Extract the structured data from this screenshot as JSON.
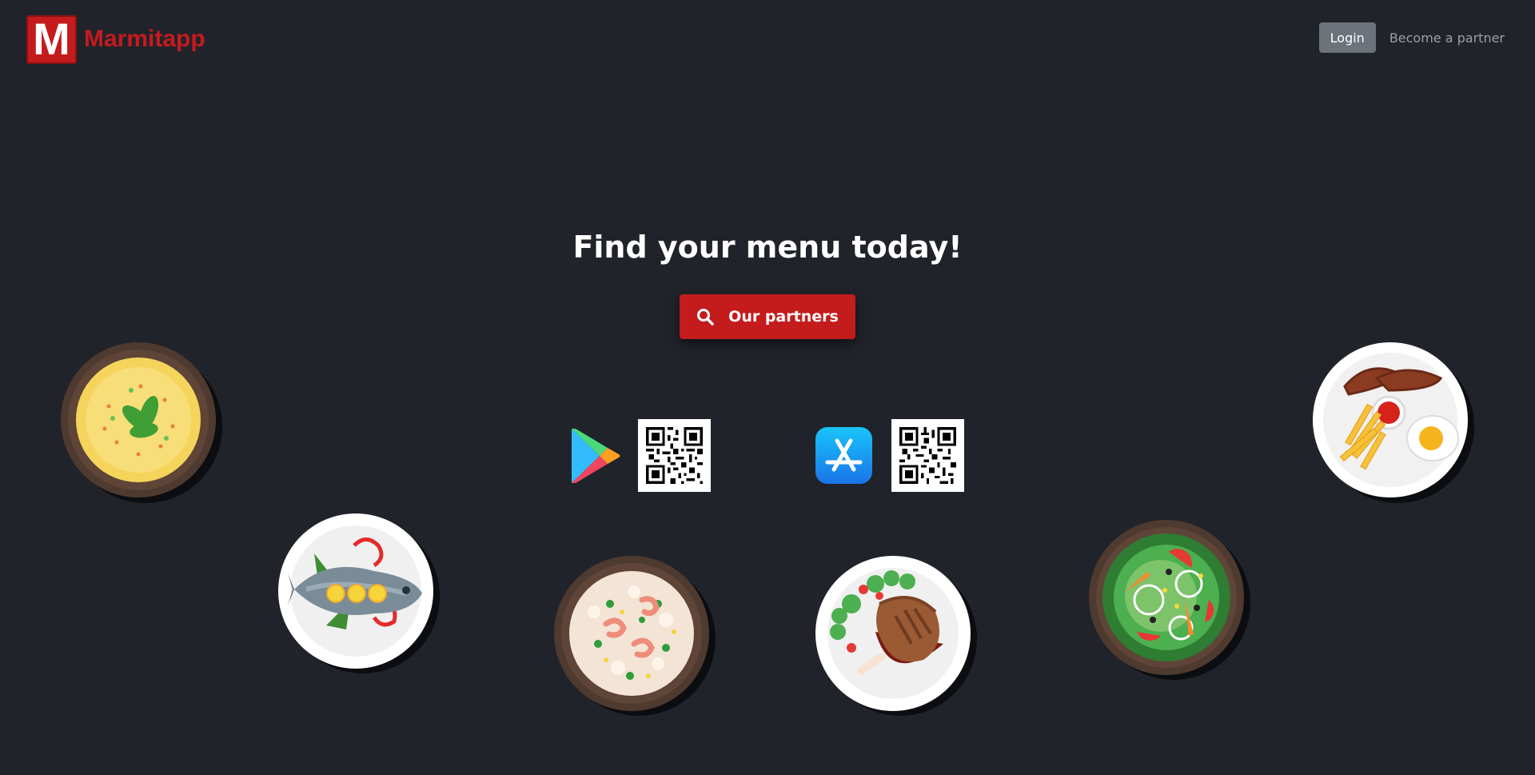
{
  "brand": {
    "logo_letter": "M",
    "name": "Marmitapp"
  },
  "nav": {
    "login_label": "Login",
    "partner_label": "Become a partner"
  },
  "hero": {
    "title": "Find your menu today!",
    "cta_label": "Our partners"
  },
  "stores": [
    {
      "name": "google-play",
      "icon": "google-play-icon"
    },
    {
      "name": "app-store",
      "icon": "app-store-icon"
    }
  ],
  "plates": [
    "omelette-plate",
    "fish-plate",
    "rice-shrimp-plate",
    "chicken-plate",
    "salad-plate",
    "breakfast-plate"
  ],
  "colors": {
    "background": "#21232a",
    "accent": "#c41b1d",
    "button_gray": "#6c737a"
  }
}
